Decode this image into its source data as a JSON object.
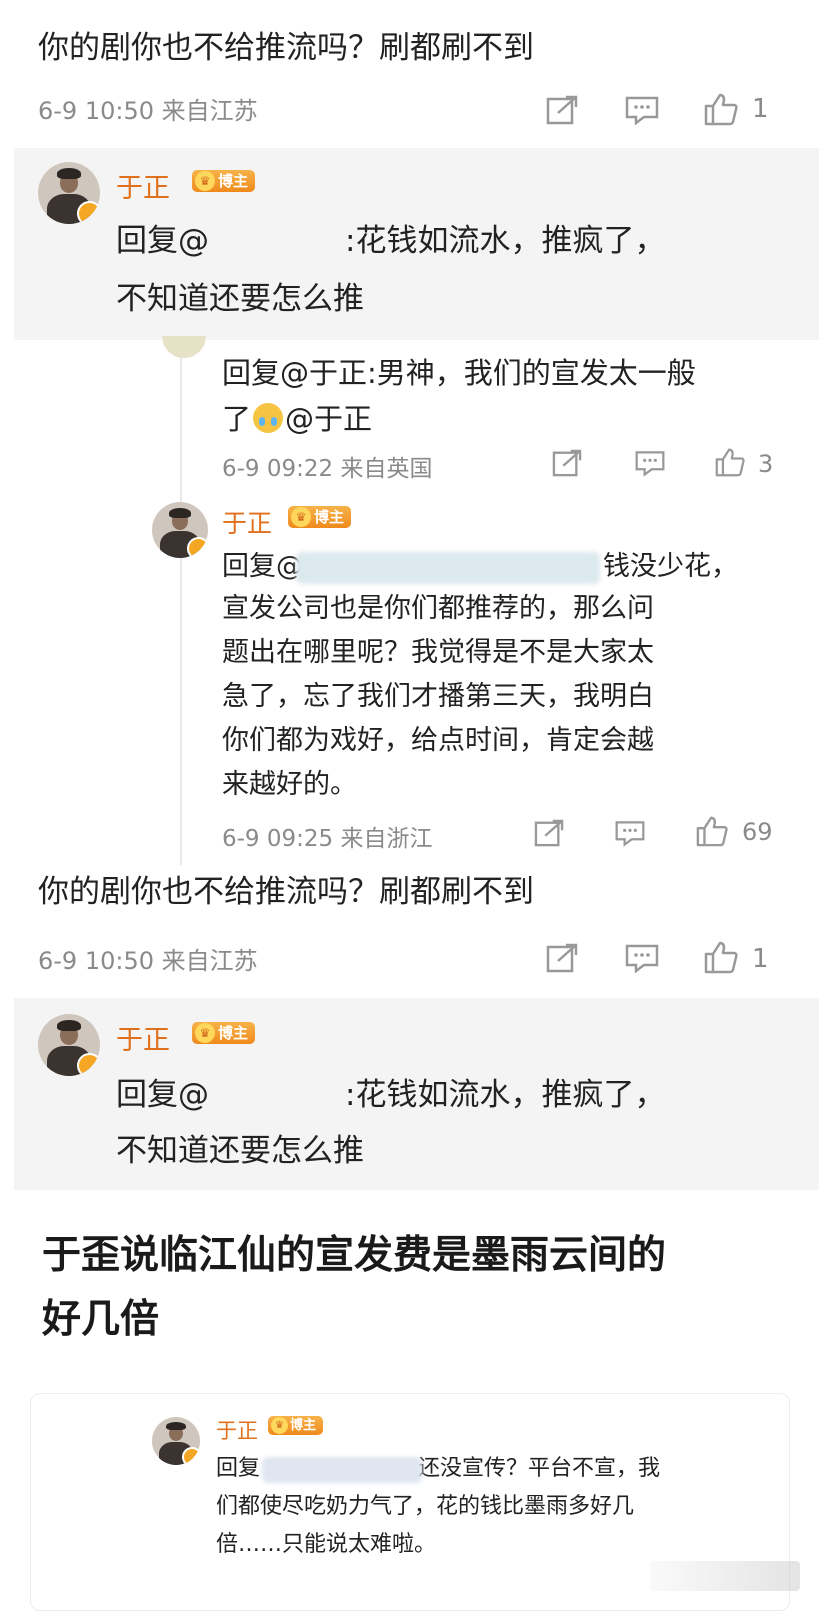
{
  "block1": {
    "comment": "你的剧你也不给推流吗？刷都刷不到",
    "meta": "6-9 10:50 来自江苏",
    "like_count": "1",
    "reply": {
      "author": "于正",
      "badge": "博主",
      "line1_prefix": "回复@",
      "line1_suffix": ":花钱如流水，推疯了，",
      "line2": "不知道还要怎么推"
    }
  },
  "block2": {
    "reply_line1": "回复@于正:男神，我们的宣发太一般",
    "reply_line2_a": "了",
    "reply_line2_b": "@于正",
    "meta": "6-9 09:22 来自英国",
    "like_count": "3",
    "sub": {
      "author": "于正",
      "badge": "博主",
      "line1_prefix": "回复@",
      "line1_suffix": "钱没少花，",
      "line2": "宣发公司也是你们都推荐的，那么问",
      "line3": "题出在哪里呢？我觉得是不是大家太",
      "line4": "急了，忘了我们才播第三天，我明白",
      "line5": "你们都为戏好，给点时间，肯定会越",
      "line6": "来越好的。",
      "meta": "6-9 09:25 来自浙江",
      "like_count": "69"
    }
  },
  "block3": {
    "comment": "你的剧你也不给推流吗？刷都刷不到",
    "meta": "6-9 10:50 来自江苏",
    "like_count": "1",
    "reply": {
      "author": "于正",
      "badge": "博主",
      "line1_prefix": "回复@",
      "line1_suffix": ":花钱如流水，推疯了，",
      "line2": "不知道还要怎么推"
    }
  },
  "headline": {
    "line1": "于歪说临江仙的宣发费是墨雨云间的",
    "line2": "好几倍"
  },
  "block4": {
    "author": "于正",
    "badge": "博主",
    "line1_prefix": "回复",
    "line1_suffix": "还没宣传？平台不宣，我",
    "line2": "们都使尽吃奶力气了，花的钱比墨雨多好几",
    "line3": "倍……只能说太难啦。"
  },
  "icons": {
    "share": "share-icon",
    "comment": "comment-icon",
    "like": "like-icon",
    "emoji": "crying-emoji-icon"
  },
  "colors": {
    "name_orange": "#e1701d",
    "meta_gray": "#8a8a8a",
    "badge_orange": "#ef8a1c"
  }
}
